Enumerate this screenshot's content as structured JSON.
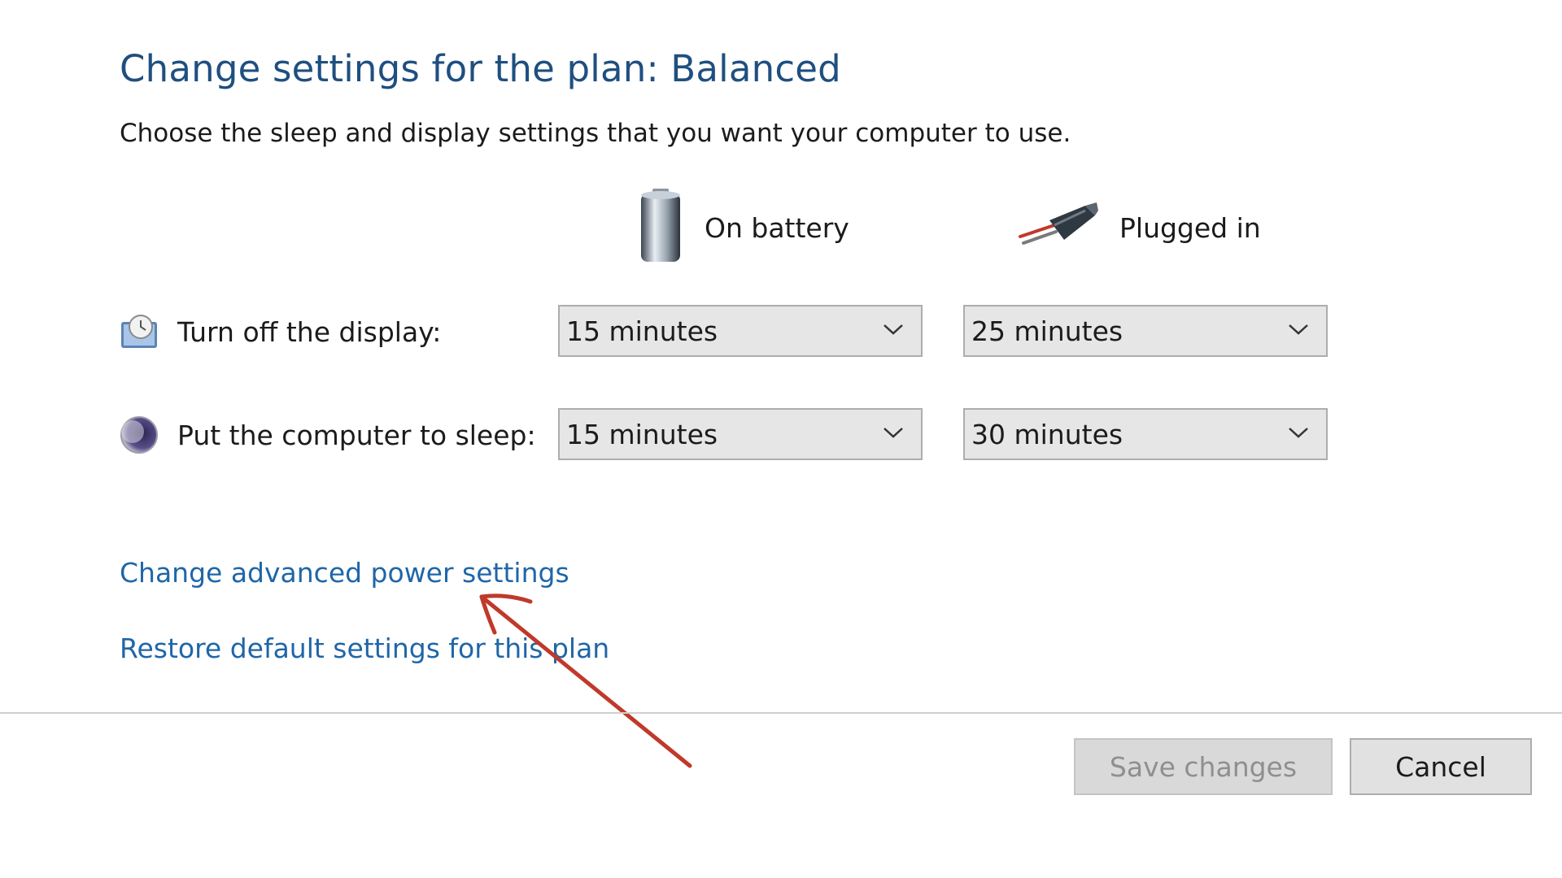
{
  "header": {
    "title": "Change settings for the plan: Balanced",
    "subtitle": "Choose the sleep and display settings that you want your computer to use."
  },
  "columns": {
    "battery": {
      "label": "On battery",
      "icon": "battery-icon"
    },
    "plugged": {
      "label": "Plugged in",
      "icon": "power-plug-icon"
    }
  },
  "rows": {
    "display": {
      "label": "Turn off the display:",
      "icon": "display-clock-icon",
      "battery_value": "15 minutes",
      "plugged_value": "25 minutes"
    },
    "sleep": {
      "label": "Put the computer to sleep:",
      "icon": "sleep-moon-icon",
      "battery_value": "15 minutes",
      "plugged_value": "30 minutes"
    }
  },
  "links": {
    "advanced": "Change advanced power settings",
    "restore": "Restore default settings for this plan"
  },
  "buttons": {
    "save": "Save changes",
    "cancel": "Cancel"
  },
  "annotation": {
    "type": "arrow",
    "color": "#c0392b"
  },
  "colors": {
    "title": "#1f4f80",
    "link": "#1f66a8",
    "dropdown_bg": "#e6e6e6"
  }
}
